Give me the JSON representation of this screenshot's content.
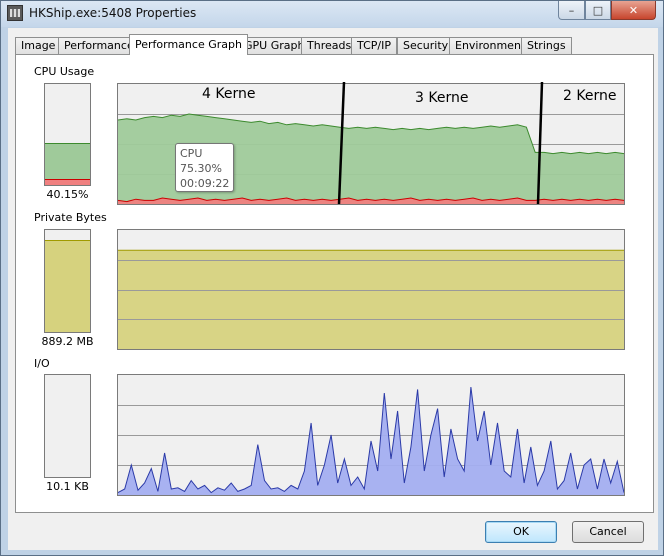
{
  "window": {
    "title": "HKShip.exe:5408 Properties"
  },
  "tabs": [
    {
      "label": "Image"
    },
    {
      "label": "Performance"
    },
    {
      "label": "Performance Graph"
    },
    {
      "label": "GPU Graph"
    },
    {
      "label": "Threads"
    },
    {
      "label": "TCP/IP"
    },
    {
      "label": "Security"
    },
    {
      "label": "Environment"
    },
    {
      "label": "Strings"
    }
  ],
  "active_tab": "Performance Graph",
  "sections": {
    "cpu": {
      "label": "CPU Usage",
      "value": "40.15%",
      "fill_fraction": 0.4015,
      "kernel_fraction": 0.05
    },
    "private_bytes": {
      "label": "Private Bytes",
      "value": "889.2 MB",
      "fill_fraction": 0.89
    },
    "io": {
      "label": "I/O",
      "value": "10.1  KB",
      "fill_fraction": 0.0
    }
  },
  "annotations": {
    "k4": "4 Kerne",
    "k3": "3 Kerne",
    "k2": "2 Kerne"
  },
  "tooltip": {
    "title": "CPU",
    "value": "75.30%",
    "time": "00:09:22"
  },
  "buttons": {
    "ok": "OK",
    "cancel": "Cancel"
  },
  "colors": {
    "cpu_fill": "#9fca9a",
    "cpu_line": "#3c8a2e",
    "kernel_fill": "#f08080",
    "kernel_line": "#cc0000",
    "bytes_fill": "#d6d27e",
    "bytes_line": "#a09a00",
    "io_fill": "#a3aef0",
    "io_line": "#2b3aa8"
  },
  "chart_data": [
    {
      "type": "area",
      "title": "",
      "series": [
        {
          "values": [
            0.7,
            0.71,
            0.7,
            0.72,
            0.73,
            0.72,
            0.74,
            0.73,
            0.75,
            0.74,
            0.73,
            0.72,
            0.71,
            0.7,
            0.69,
            0.68,
            0.69,
            0.67,
            0.68,
            0.66,
            0.67,
            0.66,
            0.65,
            0.66,
            0.65,
            0.64,
            0.63,
            0.64,
            0.63,
            0.64,
            0.63,
            0.62,
            0.63,
            0.62,
            0.63,
            0.62,
            0.63,
            0.64,
            0.63,
            0.64,
            0.63,
            0.64,
            0.65,
            0.64,
            0.65,
            0.66,
            0.64,
            0.43,
            0.43,
            0.42,
            0.43,
            0.42,
            0.43,
            0.42,
            0.43,
            0.42,
            0.43,
            0.42
          ]
        },
        {
          "values": [
            0.03,
            0.02,
            0.04,
            0.03,
            0.03,
            0.05,
            0.04,
            0.03,
            0.04,
            0.05,
            0.03,
            0.04,
            0.03,
            0.04,
            0.05,
            0.03,
            0.04,
            0.03,
            0.04,
            0.05,
            0.03,
            0.04,
            0.03,
            0.04,
            0.03,
            0.04,
            0.05,
            0.03,
            0.04,
            0.03,
            0.04,
            0.03,
            0.04,
            0.05,
            0.03,
            0.04,
            0.03,
            0.04,
            0.03,
            0.04,
            0.05,
            0.03,
            0.04,
            0.03,
            0.04,
            0.05,
            0.03,
            0.03,
            0.04,
            0.03,
            0.04,
            0.03,
            0.04,
            0.03,
            0.04,
            0.03,
            0.04,
            0.03
          ]
        }
      ]
    },
    {
      "type": "area",
      "title": "",
      "series": [
        {
          "values": [
            0.83,
            0.83,
            0.83,
            0.83,
            0.83,
            0.83,
            0.83,
            0.83,
            0.83,
            0.83,
            0.83,
            0.83,
            0.83,
            0.83,
            0.83,
            0.83,
            0.83,
            0.83,
            0.83,
            0.83
          ]
        }
      ]
    },
    {
      "type": "area",
      "title": "",
      "series": [
        {
          "values": [
            0.02,
            0.05,
            0.25,
            0.04,
            0.1,
            0.22,
            0.03,
            0.35,
            0.05,
            0.06,
            0.03,
            0.12,
            0.05,
            0.08,
            0.02,
            0.06,
            0.04,
            0.1,
            0.03,
            0.05,
            0.08,
            0.42,
            0.12,
            0.05,
            0.06,
            0.03,
            0.08,
            0.05,
            0.2,
            0.6,
            0.08,
            0.25,
            0.5,
            0.1,
            0.3,
            0.08,
            0.15,
            0.05,
            0.45,
            0.2,
            0.85,
            0.3,
            0.7,
            0.1,
            0.4,
            0.88,
            0.2,
            0.5,
            0.72,
            0.15,
            0.55,
            0.3,
            0.2,
            0.9,
            0.45,
            0.7,
            0.25,
            0.6,
            0.2,
            0.15,
            0.55,
            0.1,
            0.4,
            0.08,
            0.2,
            0.45,
            0.05,
            0.12,
            0.35,
            0.05,
            0.25,
            0.3,
            0.05,
            0.3,
            0.1,
            0.28,
            0.02
          ]
        }
      ]
    }
  ]
}
